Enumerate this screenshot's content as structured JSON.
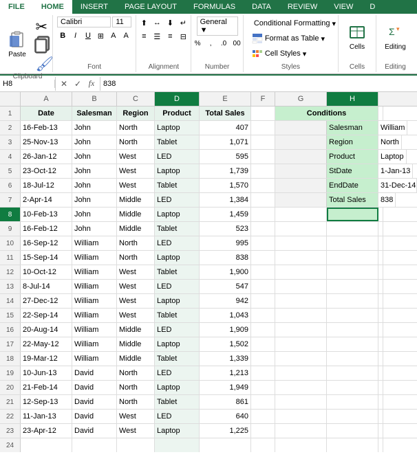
{
  "ribbon": {
    "tabs": [
      "FILE",
      "HOME",
      "INSERT",
      "PAGE LAYOUT",
      "FORMULAS",
      "DATA",
      "REVIEW",
      "VIEW",
      "D"
    ],
    "active_tab": "HOME",
    "groups": {
      "clipboard": {
        "label": "Clipboard"
      },
      "font": {
        "label": "Font"
      },
      "alignment": {
        "label": "Alignment"
      },
      "number": {
        "label": "Number"
      },
      "styles": {
        "label": "Styles",
        "btn1": "Conditional Formatting",
        "btn2": "Format as Table",
        "btn3": "Cell Styles"
      },
      "cells": {
        "label": "Cells"
      },
      "editing": {
        "label": "Editing"
      }
    }
  },
  "formula_bar": {
    "cell_ref": "H8",
    "value": "838"
  },
  "columns": {
    "headers": [
      "",
      "A",
      "B",
      "C",
      "D",
      "E",
      "F",
      "G",
      "H"
    ],
    "widths": [
      30,
      75,
      65,
      55,
      65,
      75,
      35,
      75,
      75
    ]
  },
  "rows": [
    {
      "num": 1,
      "cells": [
        "Date",
        "Salesman",
        "Region",
        "Product",
        "Total Sales",
        "",
        "",
        "Conditions",
        ""
      ]
    },
    {
      "num": 2,
      "cells": [
        "16-Feb-13",
        "John",
        "North",
        "Laptop",
        "407",
        "",
        "",
        "Salesman",
        "William"
      ]
    },
    {
      "num": 3,
      "cells": [
        "25-Nov-13",
        "John",
        "North",
        "Tablet",
        "1,071",
        "",
        "",
        "Region",
        "North"
      ]
    },
    {
      "num": 4,
      "cells": [
        "26-Jan-12",
        "John",
        "West",
        "LED",
        "595",
        "",
        "",
        "Product",
        "Laptop"
      ]
    },
    {
      "num": 5,
      "cells": [
        "23-Oct-12",
        "John",
        "West",
        "Laptop",
        "1,739",
        "",
        "",
        "StDate",
        "1-Jan-13"
      ]
    },
    {
      "num": 6,
      "cells": [
        "18-Jul-12",
        "John",
        "West",
        "Tablet",
        "1,570",
        "",
        "",
        "EndDate",
        "31-Dec-14"
      ]
    },
    {
      "num": 7,
      "cells": [
        "2-Apr-14",
        "John",
        "Middle",
        "LED",
        "1,384",
        "",
        "",
        "Total Sales",
        "838"
      ]
    },
    {
      "num": 8,
      "cells": [
        "10-Feb-13",
        "John",
        "Middle",
        "Laptop",
        "1,459",
        "",
        "",
        "",
        ""
      ]
    },
    {
      "num": 9,
      "cells": [
        "16-Feb-12",
        "John",
        "Middle",
        "Tablet",
        "523",
        "",
        "",
        "",
        ""
      ]
    },
    {
      "num": 10,
      "cells": [
        "16-Sep-12",
        "William",
        "North",
        "LED",
        "995",
        "",
        "",
        "",
        ""
      ]
    },
    {
      "num": 11,
      "cells": [
        "15-Sep-14",
        "William",
        "North",
        "Laptop",
        "838",
        "",
        "",
        "",
        ""
      ]
    },
    {
      "num": 12,
      "cells": [
        "10-Oct-12",
        "William",
        "West",
        "Tablet",
        "1,900",
        "",
        "",
        "",
        ""
      ]
    },
    {
      "num": 13,
      "cells": [
        "8-Jul-14",
        "William",
        "West",
        "LED",
        "547",
        "",
        "",
        "",
        ""
      ]
    },
    {
      "num": 14,
      "cells": [
        "27-Dec-12",
        "William",
        "West",
        "Laptop",
        "942",
        "",
        "",
        "",
        ""
      ]
    },
    {
      "num": 15,
      "cells": [
        "22-Sep-14",
        "William",
        "West",
        "Tablet",
        "1,043",
        "",
        "",
        "",
        ""
      ]
    },
    {
      "num": 16,
      "cells": [
        "20-Aug-14",
        "William",
        "Middle",
        "LED",
        "1,909",
        "",
        "",
        "",
        ""
      ]
    },
    {
      "num": 17,
      "cells": [
        "22-May-12",
        "William",
        "Middle",
        "Laptop",
        "1,502",
        "",
        "",
        "",
        ""
      ]
    },
    {
      "num": 18,
      "cells": [
        "19-Mar-12",
        "William",
        "Middle",
        "Tablet",
        "1,339",
        "",
        "",
        "",
        ""
      ]
    },
    {
      "num": 19,
      "cells": [
        "10-Jun-13",
        "David",
        "North",
        "LED",
        "1,213",
        "",
        "",
        "",
        ""
      ]
    },
    {
      "num": 20,
      "cells": [
        "21-Feb-14",
        "David",
        "North",
        "Laptop",
        "1,949",
        "",
        "",
        "",
        ""
      ]
    },
    {
      "num": 21,
      "cells": [
        "12-Sep-13",
        "David",
        "North",
        "Tablet",
        "861",
        "",
        "",
        "",
        ""
      ]
    },
    {
      "num": 22,
      "cells": [
        "11-Jan-13",
        "David",
        "West",
        "LED",
        "640",
        "",
        "",
        "",
        ""
      ]
    },
    {
      "num": 23,
      "cells": [
        "23-Apr-12",
        "David",
        "West",
        "Laptop",
        "1,225",
        "",
        "",
        "",
        ""
      ]
    },
    {
      "num": 24,
      "cells": [
        "",
        "",
        "",
        "",
        "",
        "",
        "",
        "",
        ""
      ]
    }
  ],
  "conditions": {
    "header": "Conditions",
    "rows": [
      {
        "label": "Salesman",
        "value": "William"
      },
      {
        "label": "Region",
        "value": "North"
      },
      {
        "label": "Product",
        "value": "Laptop"
      },
      {
        "label": "StDate",
        "value": "1-Jan-13"
      },
      {
        "label": "EndDate",
        "value": "31-Dec-14"
      },
      {
        "label": "Total Sales",
        "value": "838"
      }
    ]
  }
}
